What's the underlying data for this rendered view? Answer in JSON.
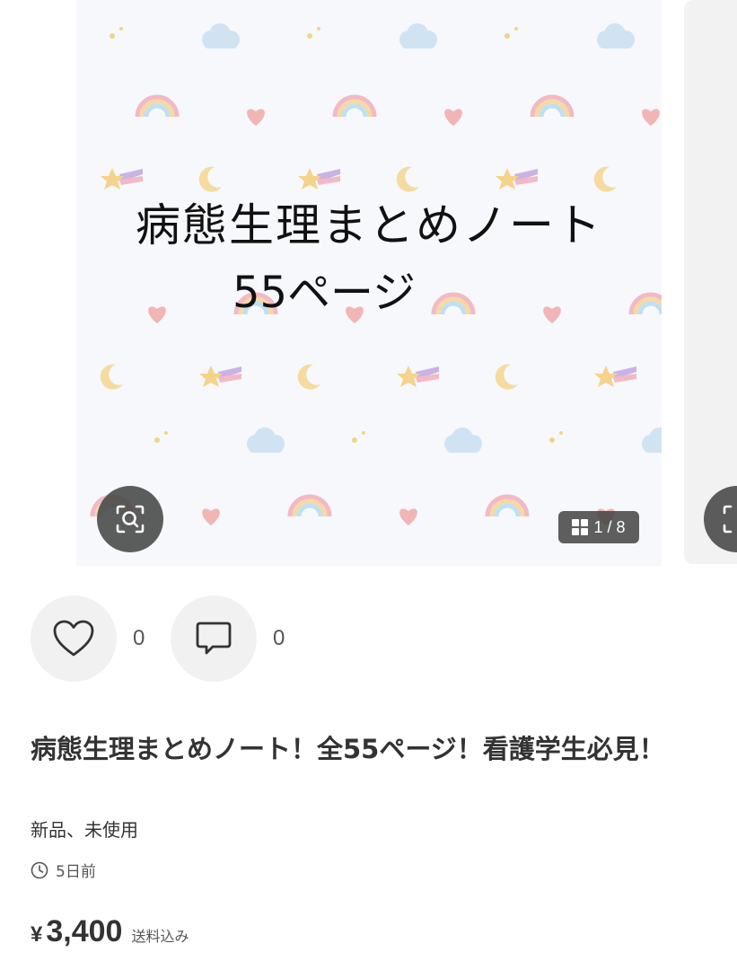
{
  "gallery": {
    "headline_line1": "病態生理まとめノート",
    "headline_line2": "55ページ",
    "page_indicator": "1 / 8",
    "pattern_icons": [
      "rainbow-icon",
      "heart-icon",
      "star-icon",
      "moon-icon",
      "cloud-icon",
      "sparkle-icon"
    ]
  },
  "actions": {
    "like_count": "0",
    "comment_count": "0"
  },
  "item": {
    "title": "病態生理まとめノート！全55ページ！看護学生必見！",
    "condition": "新品、未使用",
    "posted": "5日前",
    "currency": "¥",
    "price": "3,400",
    "shipping": "送料込み"
  },
  "colors": {
    "background": "#ffffff",
    "image_bg": "#f6f8fc",
    "overlay": "#464646",
    "action_bg": "#f1f1f1",
    "text": "#333333"
  }
}
